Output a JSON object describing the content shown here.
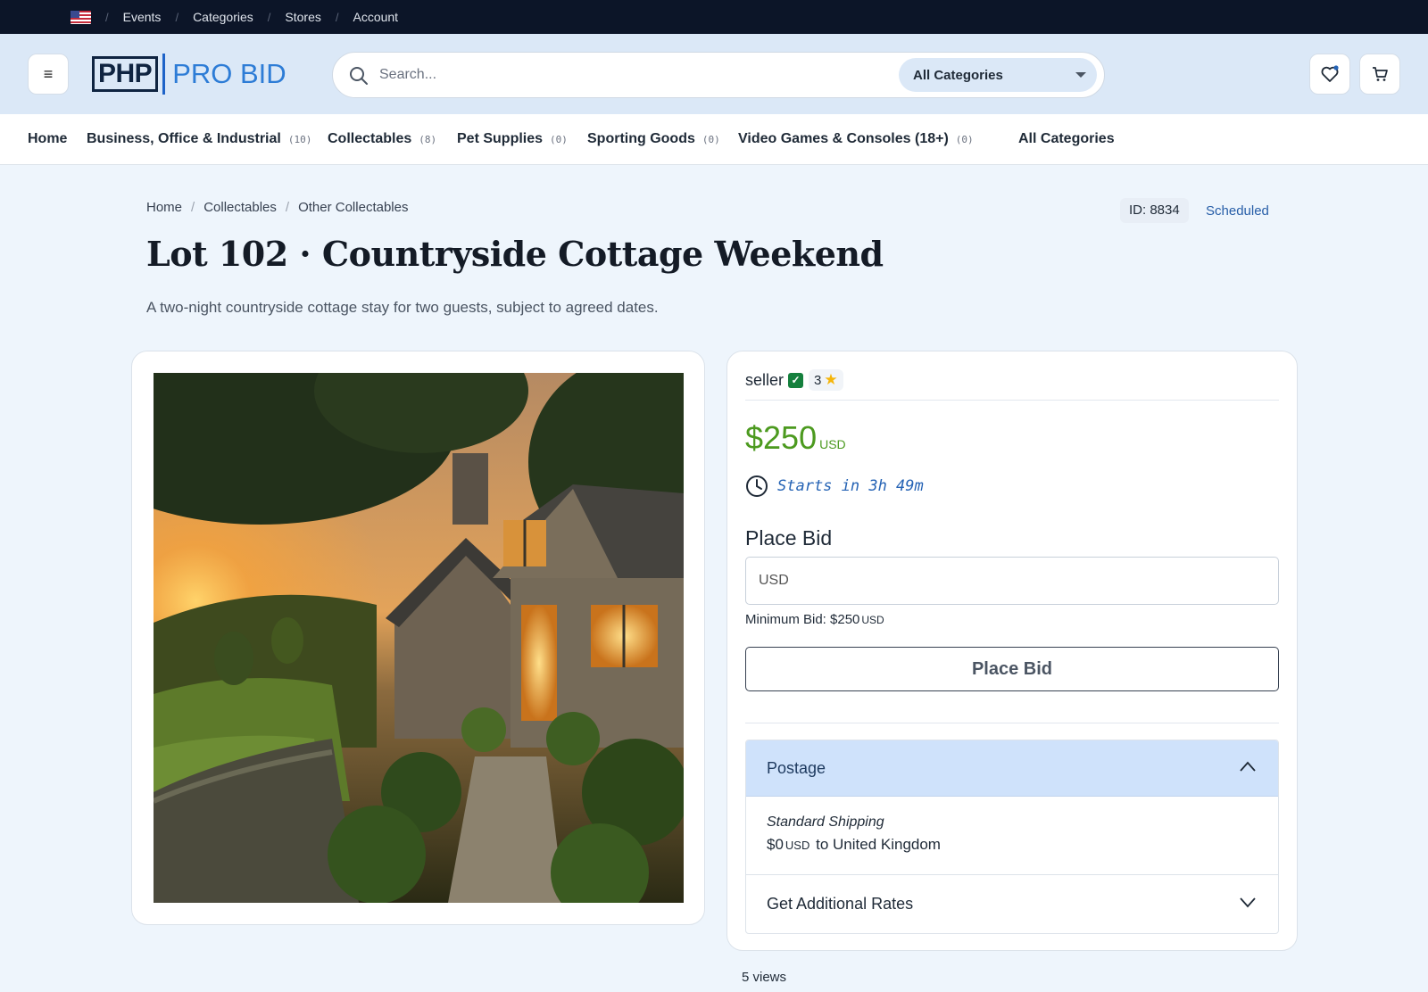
{
  "topbar": {
    "links": [
      "Events",
      "Categories",
      "Stores",
      "Account"
    ]
  },
  "header": {
    "logo_main": "PHP",
    "logo_sub": "PRO BID",
    "search_placeholder": "Search...",
    "category_select": "All Categories"
  },
  "category_nav": {
    "home": "Home",
    "items": [
      {
        "label": "Business, Office & Industrial",
        "count": "(10)"
      },
      {
        "label": "Collectables",
        "count": "(8)"
      },
      {
        "label": "Pet Supplies",
        "count": "(0)"
      },
      {
        "label": "Sporting Goods",
        "count": "(0)"
      },
      {
        "label": "Video Games & Consoles (18+)",
        "count": "(0)"
      }
    ],
    "all": "All Categories"
  },
  "breadcrumb": [
    "Home",
    "Collectables",
    "Other Collectables"
  ],
  "listing": {
    "id_label": "ID: 8834",
    "status": "Scheduled",
    "title": "Lot 102 · Countryside Cottage Weekend",
    "subtitle": "A two-night countryside cottage stay for two guests, subject to agreed dates.",
    "views": "5 views"
  },
  "bid_panel": {
    "seller": "seller",
    "verified_mark": "✓",
    "rating": "3",
    "price": "$250",
    "currency": "USD",
    "timer": "Starts in 3h 49m",
    "place_bid_heading": "Place Bid",
    "bid_input_placeholder": "USD",
    "min_bid_label": "Minimum Bid: $250",
    "min_bid_currency": "USD",
    "place_bid_button": "Place Bid",
    "postage": {
      "heading": "Postage",
      "method": "Standard Shipping",
      "amount": "$0",
      "currency": "USD",
      "destination": "to United Kingdom",
      "additional": "Get Additional Rates"
    }
  },
  "colors": {
    "topbar_bg": "#0c1528",
    "header_bg": "#dbe8f7",
    "price_green": "#4c9a1f",
    "timer_blue": "#2563b5",
    "accordion_active": "#cfe2fb"
  }
}
